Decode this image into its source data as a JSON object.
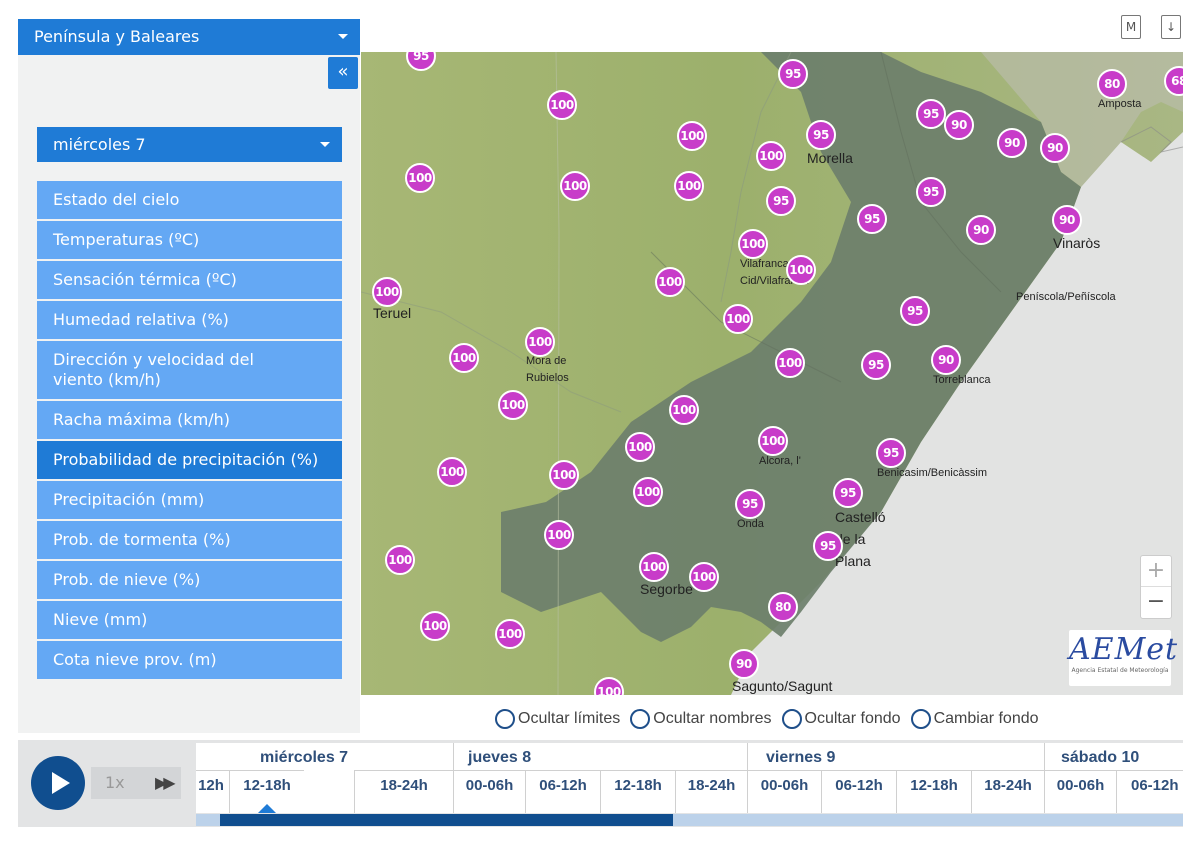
{
  "region_select": {
    "value": "Península y Baleares"
  },
  "sidebar": {
    "collapse_label": "«",
    "day_select": "miércoles 7",
    "variables": [
      {
        "label": "Estado del cielo",
        "selected": false
      },
      {
        "label": "Temperaturas (ºC)",
        "selected": false
      },
      {
        "label": "Sensación térmica (ºC)",
        "selected": false
      },
      {
        "label": "Humedad relativa (%)",
        "selected": false
      },
      {
        "label": "Dirección y velocidad del viento (km/h)",
        "selected": false
      },
      {
        "label": "Racha máxima (km/h)",
        "selected": false
      },
      {
        "label": "Probabilidad de precipitación (%)",
        "selected": true
      },
      {
        "label": "Precipitación (mm)",
        "selected": false
      },
      {
        "label": "Prob. de tormenta (%)",
        "selected": false
      },
      {
        "label": "Prob. de nieve (%)",
        "selected": false
      },
      {
        "label": "Nieve (mm)",
        "selected": false
      },
      {
        "label": "Cota nieve prov. (m)",
        "selected": false
      }
    ]
  },
  "top_icons": {
    "map_icon_label": "M",
    "download_icon_label": "↓"
  },
  "map": {
    "colors": {
      "marker": "#c83cc9",
      "highlight_region": "#6d7f6b",
      "sea": "#e3e4e3",
      "land": "#9cb06c"
    },
    "places": [
      {
        "name": "Teruel"
      },
      {
        "name": "Morella"
      },
      {
        "name": "Amposta"
      },
      {
        "name": "Vinaròs"
      },
      {
        "name": "Vilafranca del Cid/Vilafranca"
      },
      {
        "name": "Peníscola/Peñíscola"
      },
      {
        "name": "Mora de Rubielos"
      },
      {
        "name": "Torreblanca"
      },
      {
        "name": "Alcora, l'"
      },
      {
        "name": "Benicasim/Benicàssim"
      },
      {
        "name": "Onda"
      },
      {
        "name": "Castelló de la Plana"
      },
      {
        "name": "Segorbe"
      },
      {
        "name": "Sagunto/Sagunt"
      }
    ],
    "markers": [
      "95",
      "95",
      "100",
      "80",
      "68",
      "100",
      "95",
      "95",
      "90",
      "90",
      "100",
      "100",
      "100",
      "100",
      "95",
      "95",
      "90",
      "95",
      "90",
      "100",
      "100",
      "100",
      "100",
      "100",
      "90",
      "100",
      "95",
      "100",
      "100",
      "100",
      "95",
      "90",
      "100",
      "100",
      "100",
      "100",
      "100",
      "100",
      "95",
      "100",
      "95",
      "95",
      "100",
      "100",
      "100",
      "80",
      "100",
      "100",
      "90",
      "100"
    ],
    "zoom_in": "+",
    "zoom_out": "−",
    "logo": {
      "text": "AEMet",
      "subtitle": "Agencia Estatal de Meteorología"
    }
  },
  "map_options": [
    "Ocultar límites",
    "Ocultar nombres",
    "Ocultar fondo",
    "Cambiar fondo"
  ],
  "timeline": {
    "speed": "1x",
    "days": [
      "miércoles 7",
      "jueves 8",
      "viernes 9",
      "sábado 10"
    ],
    "slots": [
      "12h",
      "12-18h",
      "18-24h",
      "00-06h",
      "06-12h",
      "12-18h",
      "18-24h",
      "00-06h",
      "06-12h",
      "12-18h",
      "18-24h",
      "00-06h",
      "06-12h"
    ],
    "active_slot": "12-18h",
    "progress": 0.47
  }
}
